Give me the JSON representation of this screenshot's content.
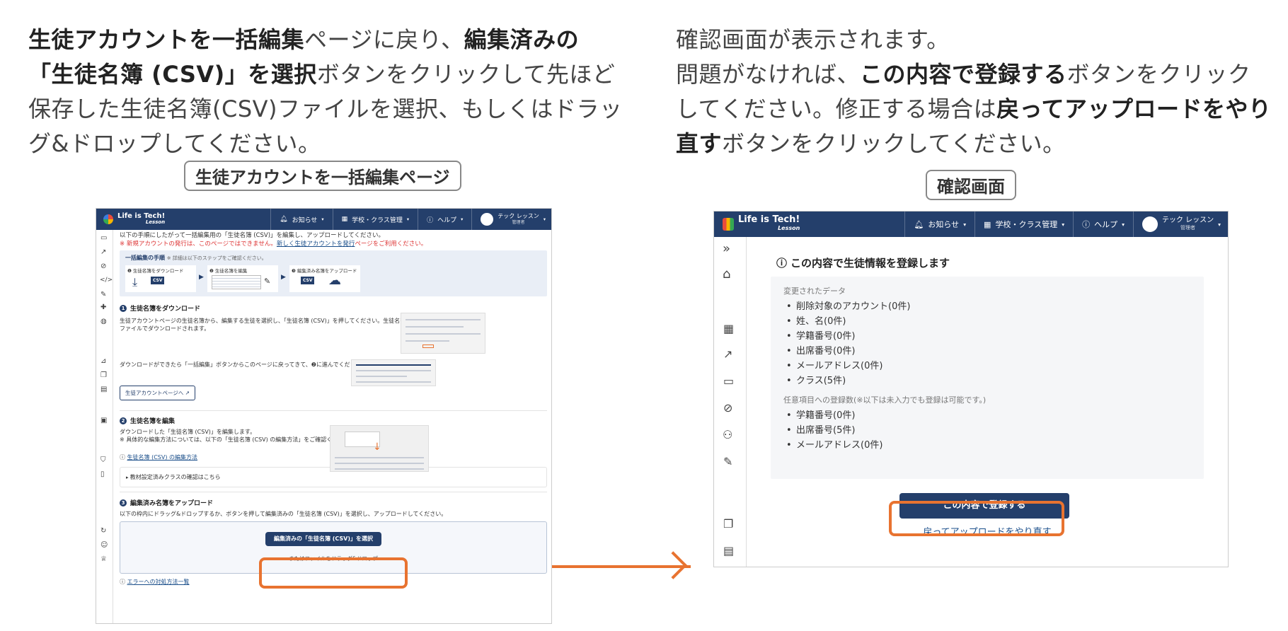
{
  "left": {
    "instruction": {
      "b1": "生徒アカウントを一括編集",
      "t1": "ページに戻り、",
      "b2": "編集済みの",
      "b3": "「生徒名簿 (CSV)」を選択",
      "t2": "ボタンをクリックして先ほど",
      "t3": "保存した生徒名簿(CSV)ファイルを選択、もしくはドラッ",
      "t4": "グ&ドロップしてください。"
    },
    "caption": "生徒アカウントを一括編集ページ",
    "screen": {
      "logo": "Life is Tech!",
      "logo_sub": "Lesson",
      "nav": {
        "news": "お知らせ",
        "school": "学校・クラス管理",
        "help": "ヘルプ",
        "user_name": "テック レッスン",
        "user_role": "管理者"
      },
      "intro_line": "以下の手順にしたがって一括編集用の「生徒名簿 (CSV)」を編集し、アップロードしてください。",
      "warning_line": "※ 新規アカウントの発行は、このページではできません。",
      "warning_link": "新しく生徒アカウントを発行",
      "warning_tail": "ページをご利用ください。",
      "steps_box": {
        "title": "一括編集の手順",
        "note": "※ 詳細は以下のステップをご確認ください。",
        "steps": [
          {
            "label": "❶ 生徒名簿をダウンロード"
          },
          {
            "label": "❷ 生徒名簿を編集"
          },
          {
            "label": "❸ 編集済み名簿をアップロード"
          }
        ],
        "csv": "CSV"
      },
      "section1": {
        "title": "生徒名簿をダウンロード",
        "num": "1",
        "desc1": "生徒アカウントページの生徒名簿から、編集する生徒を選択し、「生徒名簿 (CSV)」を押してください。生徒名簿がCSV",
        "desc2": "ファイルでダウンロードされます。",
        "desc3": "ダウンロードができたら「一括編集」ボタンからこのページに戻ってきて、❷に進んでください。",
        "button": "生徒アカウントページへ ↗"
      },
      "section2": {
        "title": "生徒名簿を編集",
        "num": "2",
        "desc1": "ダウンロードした「生徒名簿 (CSV)」を編集します。",
        "desc2": "※ 具体的な編集方法については、以下の「生徒名簿 (CSV) の編集方法」をご確認ください。",
        "link": "生徒名簿 (CSV) の編集方法",
        "accordion": "教材設定済みクラスの確認はこちら"
      },
      "section3": {
        "title": "編集済み名簿をアップロード",
        "num": "3",
        "desc": "以下の枠内にドラッグ&ドロップするか、ボタンを押して編集済みの「生徒名簿 (CSV)」を選択し、アップロードしてください。",
        "button": "編集済みの「生徒名簿 (CSV)」を選択",
        "drop_text": "またはファイルをドラッグ&ドロップ",
        "error_link": "エラーへの対処方法一覧"
      }
    }
  },
  "right": {
    "instruction": {
      "t1": "確認画面が表示されます。",
      "t2": "問題がなければ、",
      "b1": "この内容で登録する",
      "t3": "ボタンをクリック",
      "t4": "してください。修正する場合は",
      "b2": "戻ってアップロードをやり",
      "b3": "直す",
      "t5": "ボタンをクリックしてください。"
    },
    "caption": "確認画面",
    "screen": {
      "logo": "Life is Tech!",
      "logo_sub": "Lesson",
      "nav": {
        "news": "お知らせ",
        "school": "学校・クラス管理",
        "help": "ヘルプ",
        "user_name": "テック レッスン",
        "user_role": "管理者"
      },
      "heading": "この内容で生徒情報を登録します",
      "changed_label": "変更されたデータ",
      "changed_items": [
        "削除対象のアカウント(0件)",
        "姓、名(0件)",
        "学籍番号(0件)",
        "出席番号(0件)",
        "メールアドレス(0件)",
        "クラス(5件)"
      ],
      "optional_label": "任意項目への登録数(※以下は未入力でも登録は可能です。)",
      "optional_items": [
        "学籍番号(0件)",
        "出席番号(5件)",
        "メールアドレス(0件)"
      ],
      "register_button": "この内容で登録する",
      "back_link": "戻ってアップロードをやり直す"
    }
  },
  "colors": {
    "navy": "#243f6b",
    "accent": "#e87330",
    "panel": "#f5f6f8"
  }
}
